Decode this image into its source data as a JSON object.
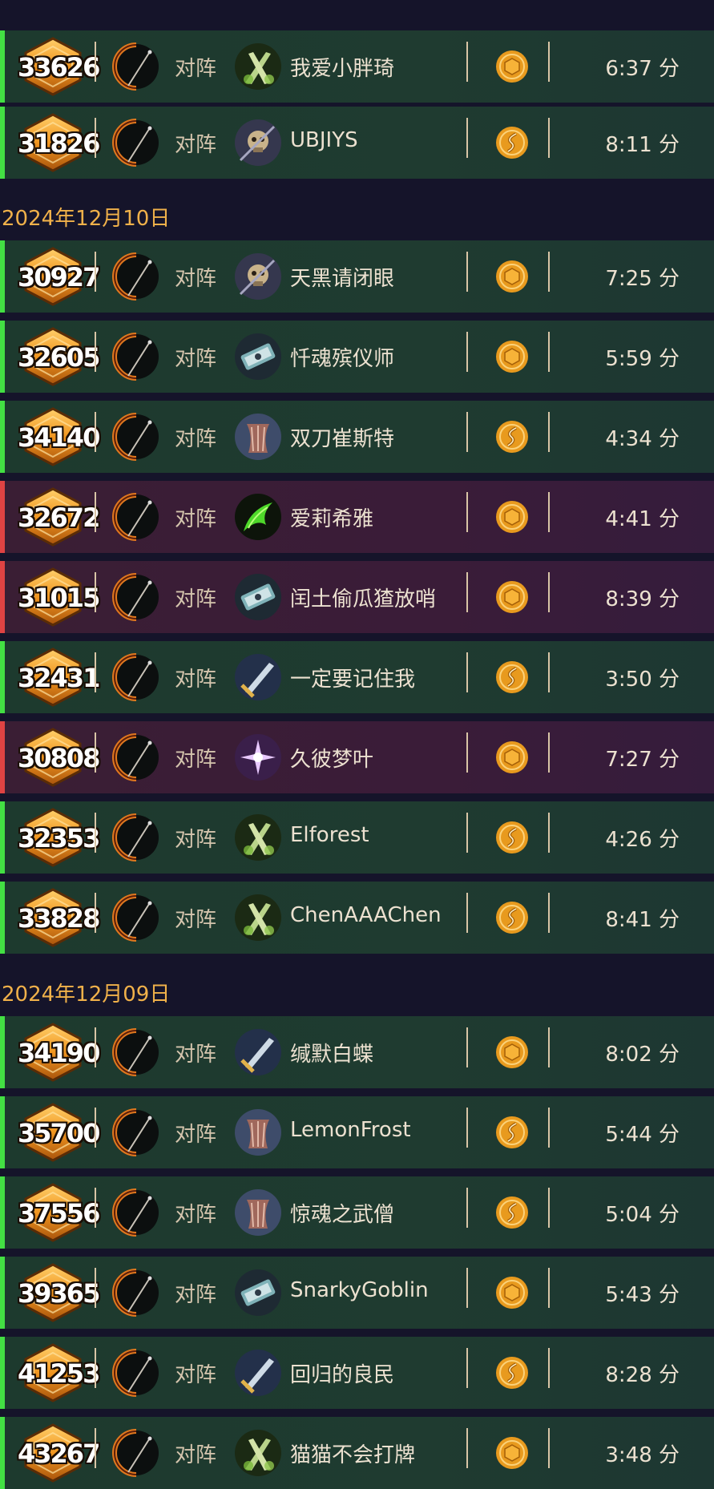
{
  "date_headers": [
    "2024年12月10日",
    "2024年12月09日"
  ],
  "rows": [
    {
      "rank": "33626",
      "mode": "对阵",
      "opponent": "我爱小胖琦",
      "avatar": "twin-blades",
      "coin": "coin-icon",
      "duration": "6:37 分",
      "result": "win"
    },
    {
      "rank": "31826",
      "mode": "对阵",
      "opponent": "UBJIYS",
      "avatar": "skull-dagger",
      "coin": "swirl-coin-icon",
      "duration": "8:11 分",
      "result": "win"
    },
    {
      "rank": "30927",
      "mode": "对阵",
      "opponent": "天黑请闭眼",
      "avatar": "skull-dagger",
      "coin": "coin-icon",
      "duration": "7:25 分",
      "result": "win"
    },
    {
      "rank": "32605",
      "mode": "对阵",
      "opponent": "忏魂殡仪师",
      "avatar": "crossed-hammers",
      "coin": "coin-icon",
      "duration": "5:59 分",
      "result": "win"
    },
    {
      "rank": "34140",
      "mode": "对阵",
      "opponent": "双刀崔斯特",
      "avatar": "stone-claw",
      "coin": "swirl-coin-icon",
      "duration": "4:34 分",
      "result": "win"
    },
    {
      "rank": "32672",
      "mode": "对阵",
      "opponent": "爱莉希雅",
      "avatar": "fel-glaive",
      "coin": "coin-icon",
      "duration": "4:41 分",
      "result": "loss"
    },
    {
      "rank": "31015",
      "mode": "对阵",
      "opponent": "闰土偷瓜猹放哨",
      "avatar": "crossed-hammers",
      "coin": "coin-icon",
      "duration": "8:39 分",
      "result": "loss"
    },
    {
      "rank": "32431",
      "mode": "对阵",
      "opponent": "一定要记住我",
      "avatar": "great-sword",
      "coin": "swirl-coin-icon",
      "duration": "3:50 分",
      "result": "win"
    },
    {
      "rank": "30808",
      "mode": "对阵",
      "opponent": "久彼梦叶",
      "avatar": "arcane-star",
      "coin": "coin-icon",
      "duration": "7:27 分",
      "result": "loss"
    },
    {
      "rank": "32353",
      "mode": "对阵",
      "opponent": "Elforest",
      "avatar": "twin-blades",
      "coin": "swirl-coin-icon",
      "duration": "4:26 分",
      "result": "win"
    },
    {
      "rank": "33828",
      "mode": "对阵",
      "opponent": "ChenAAAChen",
      "avatar": "twin-blades",
      "coin": "swirl-coin-icon",
      "duration": "8:41 分",
      "result": "win"
    },
    {
      "rank": "34190",
      "mode": "对阵",
      "opponent": "缄默白蝶",
      "avatar": "great-sword",
      "coin": "coin-icon",
      "duration": "8:02 分",
      "result": "win"
    },
    {
      "rank": "35700",
      "mode": "对阵",
      "opponent": "LemonFrost",
      "avatar": "stone-claw",
      "coin": "swirl-coin-icon",
      "duration": "5:44 分",
      "result": "win"
    },
    {
      "rank": "37556",
      "mode": "对阵",
      "opponent": "惊魂之武僧",
      "avatar": "stone-claw",
      "coin": "swirl-coin-icon",
      "duration": "5:04 分",
      "result": "win"
    },
    {
      "rank": "39365",
      "mode": "对阵",
      "opponent": "SnarkyGoblin",
      "avatar": "crossed-hammers",
      "coin": "coin-icon",
      "duration": "5:43 分",
      "result": "win"
    },
    {
      "rank": "41253",
      "mode": "对阵",
      "opponent": "回归的良民",
      "avatar": "great-sword",
      "coin": "swirl-coin-icon",
      "duration": "8:28 分",
      "result": "win"
    },
    {
      "rank": "43267",
      "mode": "对阵",
      "opponent": "猫猫不会打牌",
      "avatar": "twin-blades",
      "coin": "coin-icon",
      "duration": "3:48 分",
      "result": "win"
    }
  ],
  "colors": {
    "win_accent": "#43e043",
    "loss_accent": "#e04343",
    "date_text": "#f0b14a",
    "coin": "#e89a1e"
  }
}
